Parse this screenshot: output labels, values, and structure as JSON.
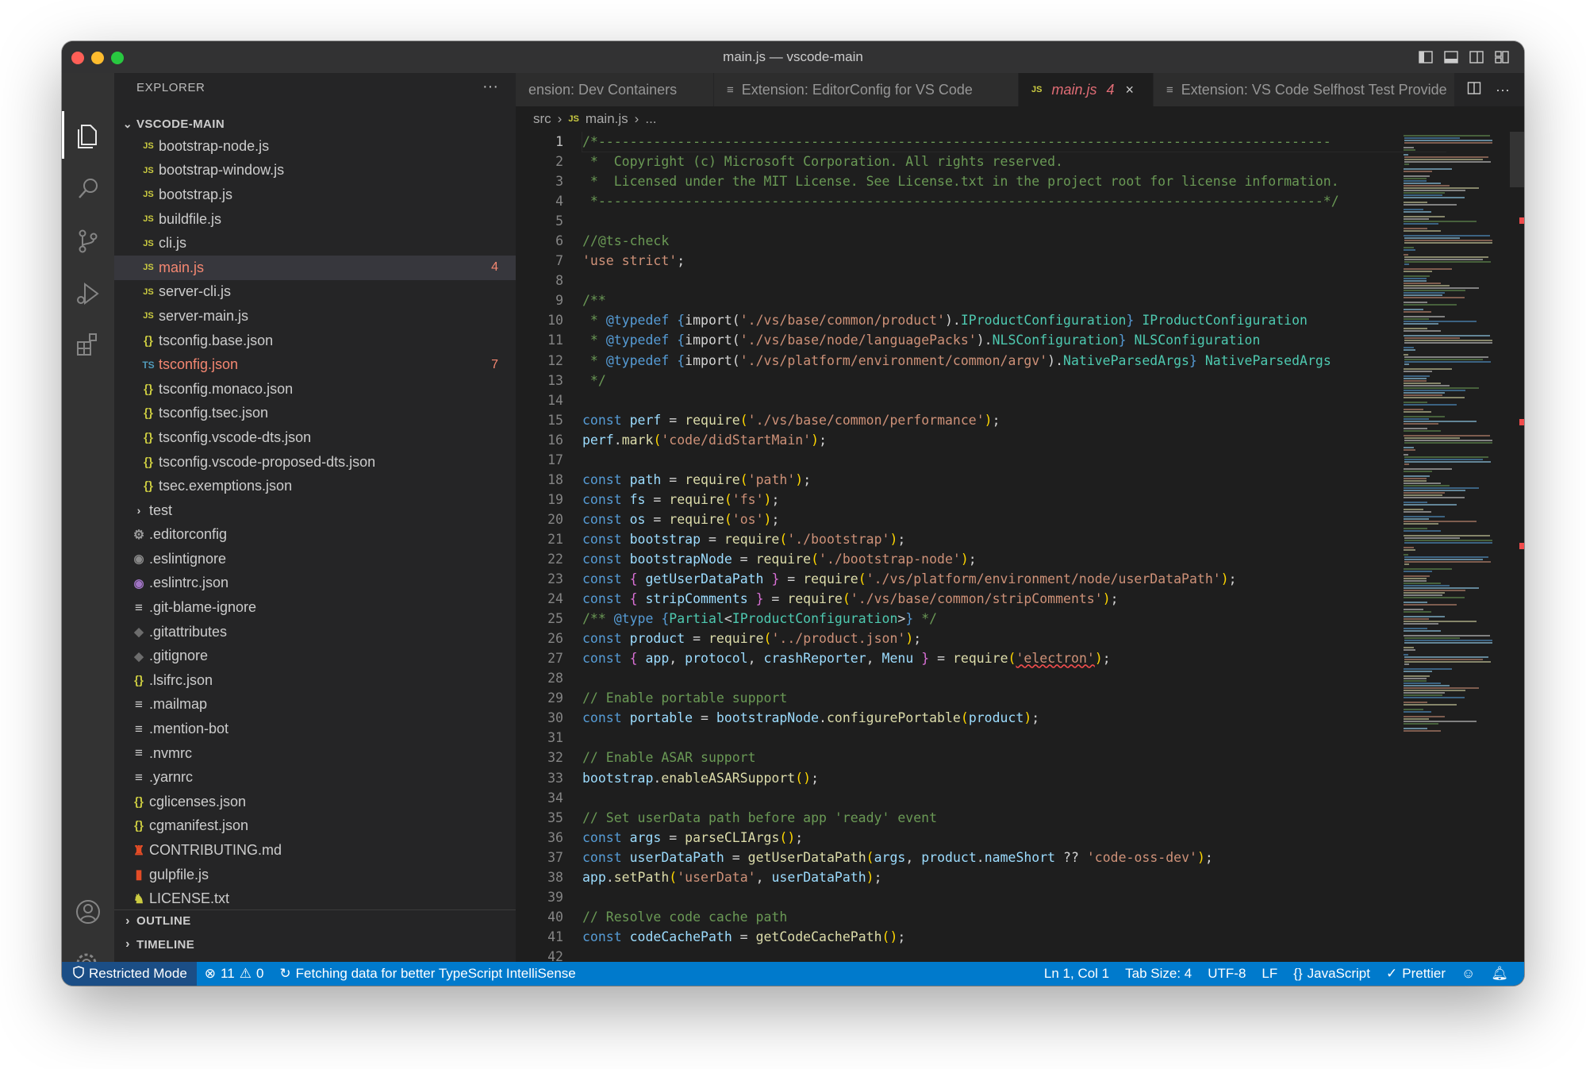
{
  "window": {
    "title": "main.js — vscode-main"
  },
  "sidebar": {
    "header": "EXPLORER",
    "more": "···",
    "root_folder": "VSCODE-MAIN",
    "files": [
      {
        "label": "bootstrap-node.js",
        "icon": "js-file-icon",
        "badge": ""
      },
      {
        "label": "bootstrap-window.js",
        "icon": "js-file-icon",
        "badge": ""
      },
      {
        "label": "bootstrap.js",
        "icon": "js-file-icon",
        "badge": ""
      },
      {
        "label": "buildfile.js",
        "icon": "js-file-icon",
        "badge": ""
      },
      {
        "label": "cli.js",
        "icon": "js-file-icon",
        "badge": ""
      },
      {
        "label": "main.js",
        "icon": "js-file-icon",
        "badge": "4"
      },
      {
        "label": "server-cli.js",
        "icon": "js-file-icon",
        "badge": ""
      },
      {
        "label": "server-main.js",
        "icon": "js-file-icon",
        "badge": ""
      },
      {
        "label": "tsconfig.base.json",
        "icon": "json-file-icon",
        "badge": ""
      },
      {
        "label": "tsconfig.json",
        "icon": "tsconfig-file-icon",
        "badge": "7"
      },
      {
        "label": "tsconfig.monaco.json",
        "icon": "json-file-icon",
        "badge": ""
      },
      {
        "label": "tsconfig.tsec.json",
        "icon": "json-file-icon",
        "badge": ""
      },
      {
        "label": "tsconfig.vscode-dts.json",
        "icon": "json-file-icon",
        "badge": ""
      },
      {
        "label": "tsconfig.vscode-proposed-dts.json",
        "icon": "json-file-icon",
        "badge": ""
      },
      {
        "label": "tsec.exemptions.json",
        "icon": "json-file-icon",
        "badge": ""
      }
    ],
    "root_items": [
      {
        "label": "test",
        "icon": "chevron-right-icon"
      },
      {
        "label": ".editorconfig",
        "icon": "gear-icon"
      },
      {
        "label": ".eslintignore",
        "icon": "circle-icon"
      },
      {
        "label": ".eslintrc.json",
        "icon": "eslint-icon"
      },
      {
        "label": ".git-blame-ignore",
        "icon": "lines-icon"
      },
      {
        "label": ".gitattributes",
        "icon": "git-icon"
      },
      {
        "label": ".gitignore",
        "icon": "git-icon"
      },
      {
        "label": ".lsifrc.json",
        "icon": "json-file-icon"
      },
      {
        "label": ".mailmap",
        "icon": "lines-icon"
      },
      {
        "label": ".mention-bot",
        "icon": "lines-icon"
      },
      {
        "label": ".nvmrc",
        "icon": "lines-icon"
      },
      {
        "label": ".yarnrc",
        "icon": "lines-icon"
      },
      {
        "label": "cglicenses.json",
        "icon": "json-file-icon"
      },
      {
        "label": "cgmanifest.json",
        "icon": "json-file-icon"
      },
      {
        "label": "CONTRIBUTING.md",
        "icon": "contributing-icon"
      },
      {
        "label": "gulpfile.js",
        "icon": "gulp-icon"
      },
      {
        "label": "LICENSE.txt",
        "icon": "license-icon"
      }
    ],
    "outline": "OUTLINE",
    "timeline": "TIMELINE"
  },
  "tabs": [
    {
      "label": "ension: Dev Containers",
      "icon": "",
      "badge": "",
      "active": false
    },
    {
      "label": "Extension: EditorConfig for VS Code",
      "icon": "preview-icon",
      "badge": "",
      "active": false
    },
    {
      "label": "main.js",
      "icon": "js-file-icon",
      "badge": "4",
      "active": true
    },
    {
      "label": "Extension: VS Code Selfhost Test Provide",
      "icon": "preview-icon",
      "badge": "",
      "active": false
    }
  ],
  "tab_close": "×",
  "breadcrumb": {
    "folder": "src",
    "file": "main.js",
    "rest": "..."
  },
  "editor": {
    "line_numbers": [
      "1",
      "2",
      "3",
      "4",
      "5",
      "6",
      "7",
      "8",
      "9",
      "10",
      "11",
      "12",
      "13",
      "14",
      "15",
      "16",
      "17",
      "18",
      "19",
      "20",
      "21",
      "22",
      "23",
      "24",
      "25",
      "26",
      "27",
      "28",
      "29",
      "30",
      "31",
      "32",
      "33",
      "34",
      "35",
      "36",
      "37",
      "38",
      "39",
      "40",
      "41",
      "42"
    ],
    "lines": [
      "/*---------------------------------------------------------------------------------------------",
      " *  Copyright (c) Microsoft Corporation. All rights reserved.",
      " *  Licensed under the MIT License. See License.txt in the project root for license information.",
      " *--------------------------------------------------------------------------------------------*/",
      "",
      "//@ts-check",
      "'use strict';",
      "",
      "/**",
      " * @typedef {import('./vs/base/common/product').IProductConfiguration} IProductConfiguration",
      " * @typedef {import('./vs/base/node/languagePacks').NLSConfiguration} NLSConfiguration",
      " * @typedef {import('./vs/platform/environment/common/argv').NativeParsedArgs} NativeParsedArgs",
      " */",
      "",
      "const perf = require('./vs/base/common/performance');",
      "perf.mark('code/didStartMain');",
      "",
      "const path = require('path');",
      "const fs = require('fs');",
      "const os = require('os');",
      "const bootstrap = require('./bootstrap');",
      "const bootstrapNode = require('./bootstrap-node');",
      "const { getUserDataPath } = require('./vs/platform/environment/node/userDataPath');",
      "const { stripComments } = require('./vs/base/common/stripComments');",
      "/** @type {Partial<IProductConfiguration>} */",
      "const product = require('../product.json');",
      "const { app, protocol, crashReporter, Menu } = require('electron');",
      "",
      "// Enable portable support",
      "const portable = bootstrapNode.configurePortable(product);",
      "",
      "// Enable ASAR support",
      "bootstrap.enableASARSupport();",
      "",
      "// Set userData path before app 'ready' event",
      "const args = parseCLIArgs();",
      "const userDataPath = getUserDataPath(args, product.nameShort ?? 'code-oss-dev');",
      "app.setPath('userData', userDataPath);",
      "",
      "// Resolve code cache path",
      "const codeCachePath = getCodeCachePath();",
      ""
    ]
  },
  "statusbar": {
    "restricted": "Restricted Mode",
    "errors": "11",
    "warnings": "0",
    "fetching": "Fetching data for better TypeScript IntelliSense",
    "position": "Ln 1, Col 1",
    "tab_size": "Tab Size: 4",
    "encoding": "UTF-8",
    "eol": "LF",
    "language": "JavaScript",
    "formatter": "Prettier"
  },
  "colors": {
    "accent": "#007acc",
    "restricted_bg": "#1b4e86",
    "error": "#f48771",
    "js_icon": "#cbcb41"
  }
}
